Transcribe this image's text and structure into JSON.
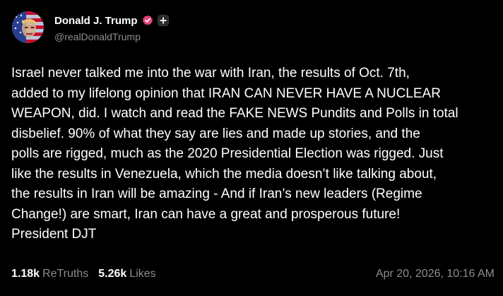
{
  "colors": {
    "background": "#000000",
    "text_primary": "#ffffff",
    "text_secondary": "#8c8c94",
    "verified_badge": "#e5457a"
  },
  "author": {
    "display_name": "Donald J. Trump",
    "handle": "@realDonaldTrump",
    "verified_icon": "verified-badge-icon",
    "follow_icon": "plus-icon"
  },
  "post": {
    "lines": [
      "Israel never talked me into the war with Iran, the results of Oct. 7th,",
      "added to my lifelong opinion that IRAN CAN NEVER HAVE A NUCLEAR",
      "WEAPON, did. I watch and read the FAKE NEWS Pundits and Polls in total",
      "disbelief. 90% of what they say are lies and made up stories, and the",
      "polls are rigged, much as the 2020 Presidential Election was rigged. Just",
      "like the results in Venezuela, which the media doesn’t like talking about,",
      "the results in Iran will be amazing - And if Iran’s new leaders (Regime",
      "Change!) are smart, Iran can have a great and prosperous future!",
      "President DJT"
    ]
  },
  "stats": {
    "retruths_count": "1.18k",
    "retruths_label": "ReTruths",
    "likes_count": "5.26k",
    "likes_label": "Likes"
  },
  "timestamp": "Apr 20, 2026, 10:16 AM"
}
